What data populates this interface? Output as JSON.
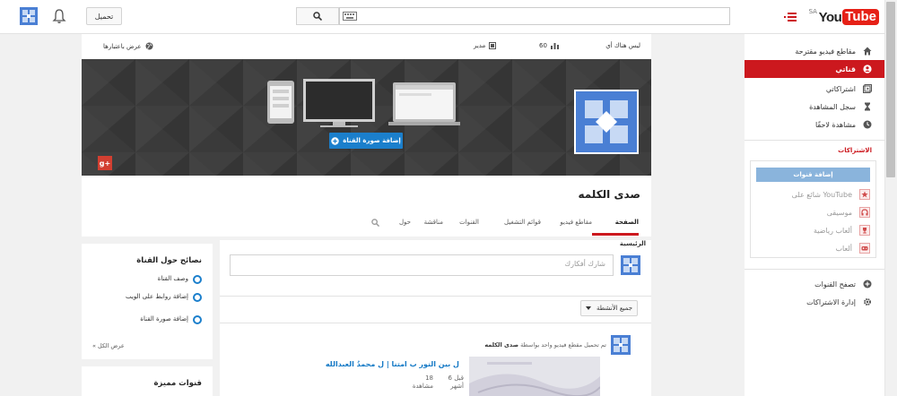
{
  "topbar": {
    "logo_you": "You",
    "logo_tube": "Tube",
    "region": "SA",
    "upload_label": "تحميل"
  },
  "sidebar": {
    "items": [
      {
        "label": "مقاطع فيديو مقترحة",
        "icon": "home-icon"
      },
      {
        "label": "قناتي",
        "icon": "person-icon",
        "active": true
      },
      {
        "label": "اشتراكاتي",
        "icon": "subscriptions-icon"
      },
      {
        "label": "سجل المشاهدة",
        "icon": "hourglass-icon"
      },
      {
        "label": "مشاهدة لاحقًا",
        "icon": "clock-icon"
      }
    ],
    "subs_heading": "الاشتراكات",
    "add_channels_label": "إضافة قنوات",
    "subs": [
      {
        "label": "شائع على YouTube",
        "icon": "star-icon"
      },
      {
        "label": "موسيقى",
        "icon": "headphones-icon"
      },
      {
        "label": "ألعاب رياضية",
        "icon": "trophy-icon"
      },
      {
        "label": "ألعاب",
        "icon": "gamepad-icon"
      }
    ],
    "bottom": [
      {
        "label": "تصفح القنوات",
        "icon": "plus-circle-icon"
      },
      {
        "label": "إدارة الاشتراكات",
        "icon": "gear-icon"
      }
    ]
  },
  "channel": {
    "status_label": "ليس هناك أي",
    "views_count": "60",
    "role_label": "مدير",
    "view_as_label": "عرض باعتبارها",
    "add_art_label": "إضافة صورة القناة",
    "gplus_label": "g+",
    "title": "صدى الكلمه",
    "tabs": [
      "الصفحة",
      "مقاطع فيديو",
      "قوائم التشغيل",
      "القنوات",
      "مناقشة",
      "حول"
    ]
  },
  "feed": {
    "section_label": "الرئيسية",
    "post_placeholder": "شارك أفكارك",
    "activity_filter": "جميع الأنشطة",
    "activity_prefix": "تم تحميل مقطع فيديو واحد بواسطة",
    "activity_channel": "صدى الكلمه",
    "video_title": "ل بين النور ب امتنا | ل محمدُ العبدالله",
    "video_age": "قبل 6 أشهر",
    "video_views": "18 مشاهدة"
  },
  "tips": {
    "title": "نصائح حول القناة",
    "items": [
      "وصف القناة",
      "إضافة روابط على الويب",
      "إضافة صورة القناة"
    ],
    "view_all": "« عرض الكل"
  },
  "featured": {
    "title": "قنوات مميزة"
  },
  "colors": {
    "accent_red": "#cc181e",
    "link_blue": "#167ac6",
    "button_blue": "#1b7fcc"
  }
}
